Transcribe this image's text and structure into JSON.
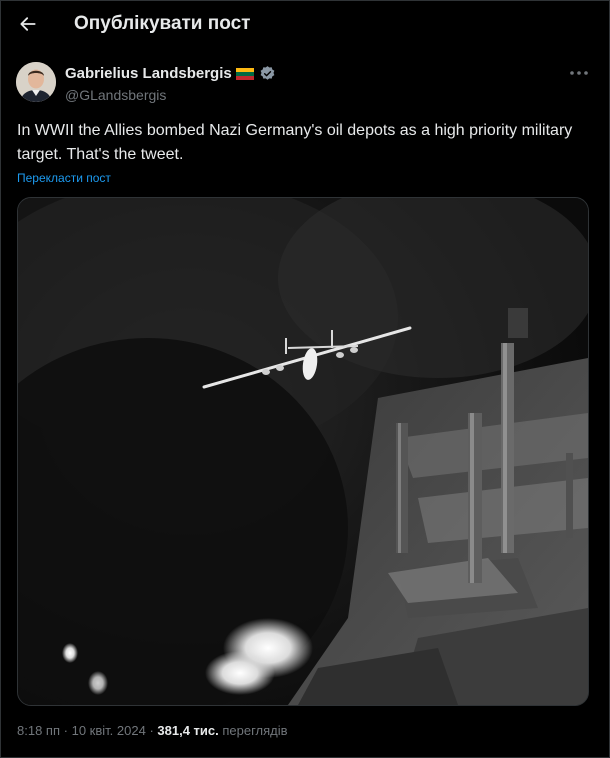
{
  "header": {
    "title": "Опублікувати пост",
    "back_icon": "arrow-left-icon"
  },
  "author": {
    "name": "Gabrielius Landsbergis",
    "handle": "@GLandsbergis",
    "flag_colors": [
      "#FDB913",
      "#006A44",
      "#C1272D"
    ],
    "verified_color": "#8b98a5"
  },
  "tweet": {
    "text": "In WWII the Allies bombed Nazi Germany's oil depots as a high priority military target. That's the tweet.",
    "translate_label": "Перекласти пост"
  },
  "media": {
    "description_icon": "photo-bomber-over-refinery"
  },
  "meta": {
    "time": "8:18 пп",
    "date": "10 квіт. 2024",
    "separator": "·",
    "views_count": "381,4 тис.",
    "views_label": "переглядів"
  },
  "colors": {
    "background": "#000000",
    "accent": "#1d9bf0",
    "secondary_text": "#71767b"
  }
}
